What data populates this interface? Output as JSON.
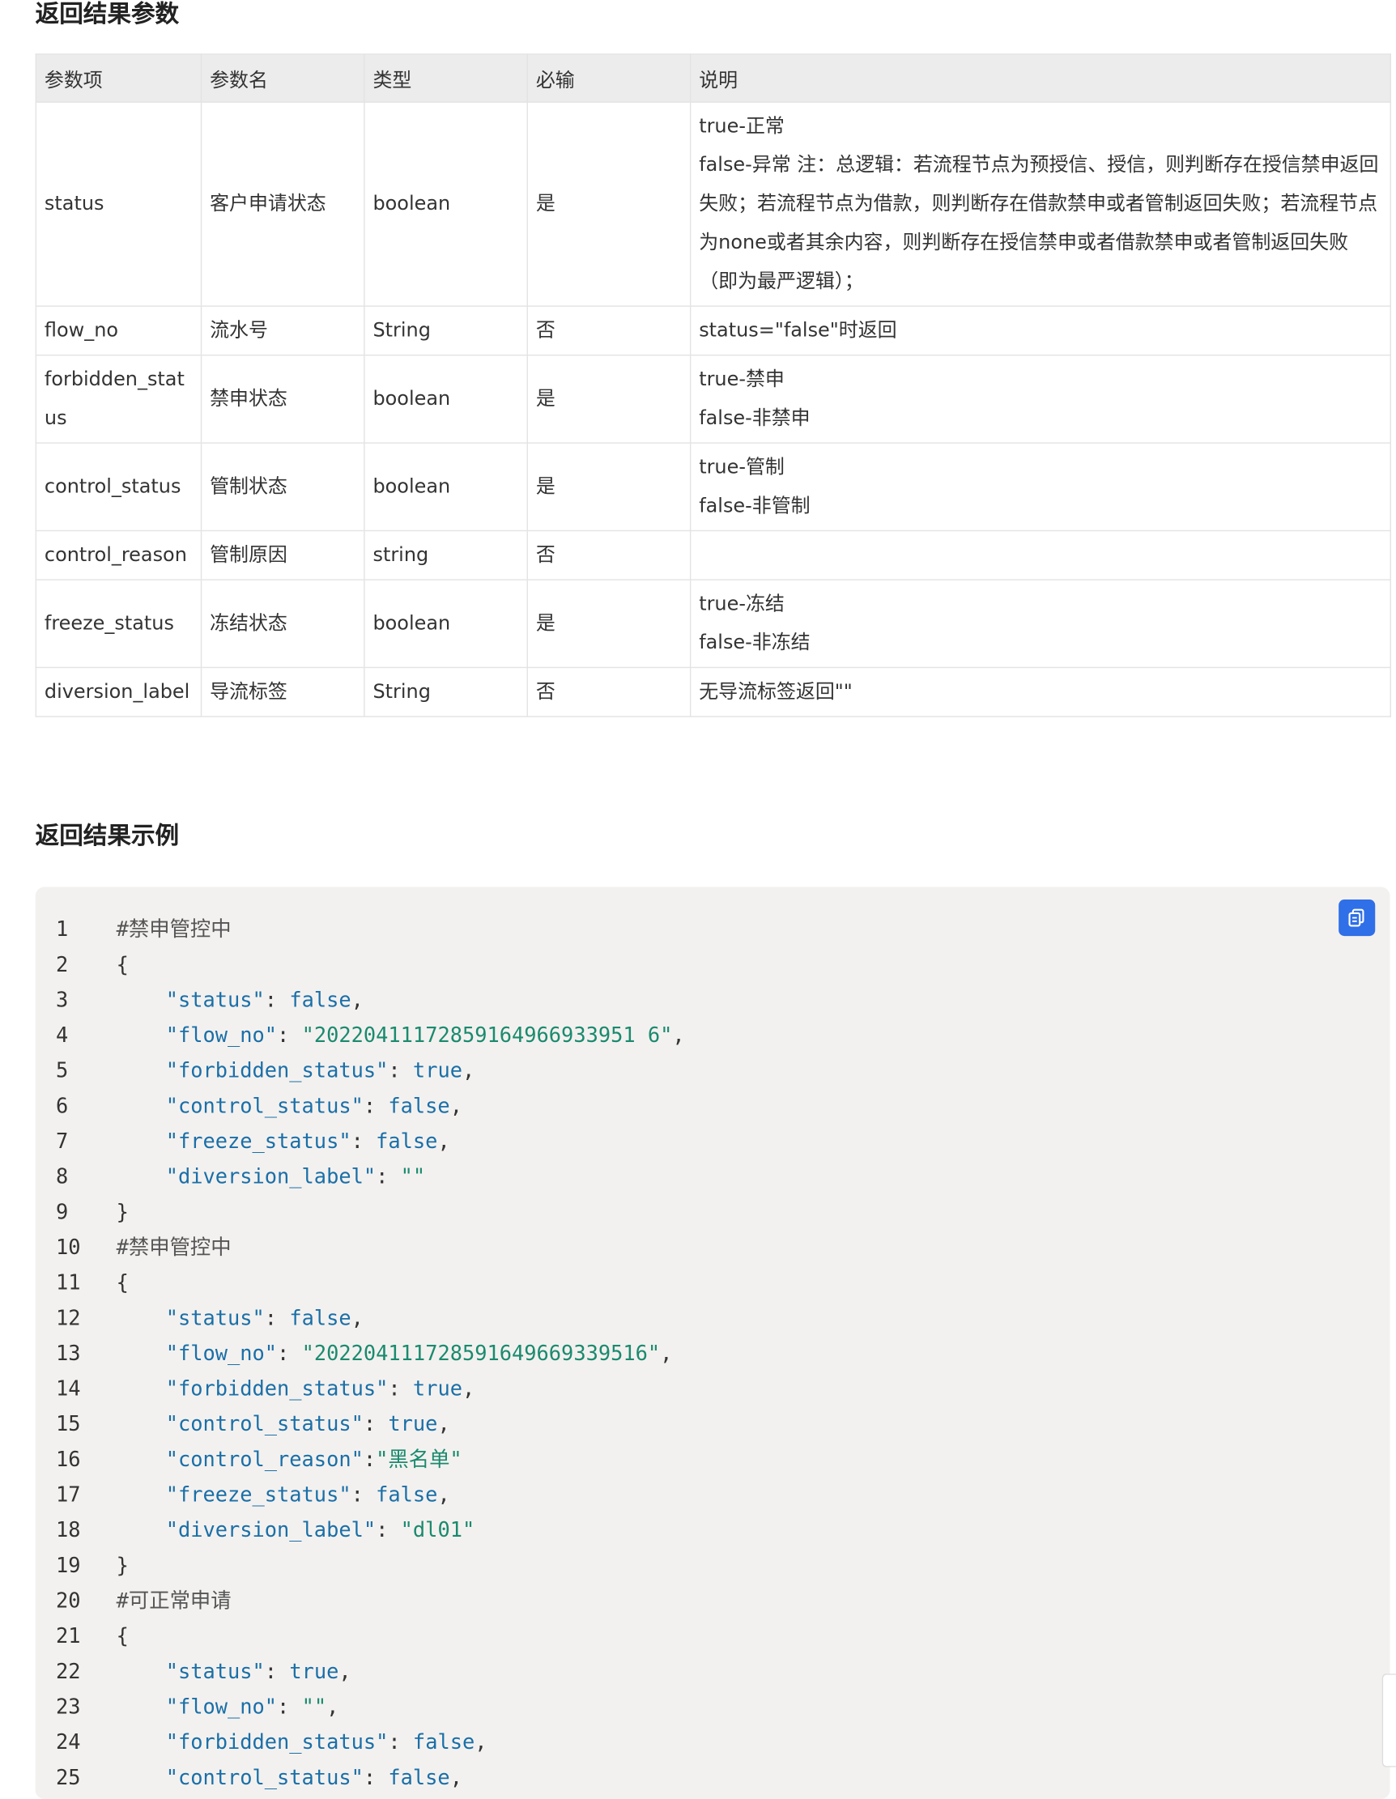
{
  "headings": {
    "params": "返回结果参数",
    "example": "返回结果示例"
  },
  "table": {
    "headers": [
      "参数项",
      "参数名",
      "类型",
      "必输",
      "说明"
    ],
    "rows": [
      {
        "field": "status",
        "name": "客户申请状态",
        "type": "boolean",
        "required": "是",
        "desc": [
          "true-正常",
          "false-异常 注：总逻辑：若流程节点为预授信、授信，则判断存在授信禁申返回失败；若流程节点为借款，则判断存在借款禁申或者管制返回失败；若流程节点为none或者其余内容，则判断存在授信禁申或者借款禁申或者管制返回失败（即为最严逻辑）；"
        ]
      },
      {
        "field": "flow_no",
        "name": "流水号",
        "type": "String",
        "required": "否",
        "desc": [
          "status=\"false\"时返回"
        ]
      },
      {
        "field": "forbidden_status",
        "name": "禁申状态",
        "type": "boolean",
        "required": "是",
        "desc": [
          "true-禁申",
          "false-非禁申"
        ]
      },
      {
        "field": "control_status",
        "name": "管制状态",
        "type": "boolean",
        "required": "是",
        "desc": [
          "true-管制",
          "false-非管制"
        ]
      },
      {
        "field": "control_reason",
        "name": "管制原因",
        "type": "string",
        "required": "否",
        "desc": [
          ""
        ]
      },
      {
        "field": "freeze_status",
        "name": "冻结状态",
        "type": "boolean",
        "required": "是",
        "desc": [
          "true-冻结",
          "false-非冻结"
        ]
      },
      {
        "field": "diversion_label",
        "name": "导流标签",
        "type": "String",
        "required": "否",
        "desc": [
          "无导流标签返回\"\""
        ]
      }
    ]
  },
  "code": {
    "copy_icon": "copy-icon",
    "lines": [
      {
        "n": "1",
        "t": "#禁申管控中"
      },
      {
        "n": "2",
        "t": "{"
      },
      {
        "n": "3",
        "t": "    \"status\": false,"
      },
      {
        "n": "4",
        "t": "    \"flow_no\": \"20220411172859164966933951 6\","
      },
      {
        "n": "5",
        "t": "    \"forbidden_status\": true,"
      },
      {
        "n": "6",
        "t": "    \"control_status\": false,"
      },
      {
        "n": "7",
        "t": "    \"freeze_status\": false,"
      },
      {
        "n": "8",
        "t": "    \"diversion_label\": \"\""
      },
      {
        "n": "9",
        "t": "}"
      },
      {
        "n": "10",
        "t": "#禁申管控中"
      },
      {
        "n": "11",
        "t": "{"
      },
      {
        "n": "12",
        "t": "    \"status\": false,"
      },
      {
        "n": "13",
        "t": "    \"flow_no\": \"202204111728591649669339516\","
      },
      {
        "n": "14",
        "t": "    \"forbidden_status\": true,"
      },
      {
        "n": "15",
        "t": "    \"control_status\": true,"
      },
      {
        "n": "16",
        "t": "    \"control_reason\":\"黑名单\""
      },
      {
        "n": "17",
        "t": "    \"freeze_status\": false,"
      },
      {
        "n": "18",
        "t": "    \"diversion_label\": \"dl01\""
      },
      {
        "n": "19",
        "t": "}"
      },
      {
        "n": "20",
        "t": "#可正常申请"
      },
      {
        "n": "21",
        "t": "{"
      },
      {
        "n": "22",
        "t": "    \"status\": true,"
      },
      {
        "n": "23",
        "t": "    \"flow_no\": \"\","
      },
      {
        "n": "24",
        "t": "    \"forbidden_status\": false,"
      },
      {
        "n": "25",
        "t": "    \"control_status\": false,"
      }
    ]
  }
}
